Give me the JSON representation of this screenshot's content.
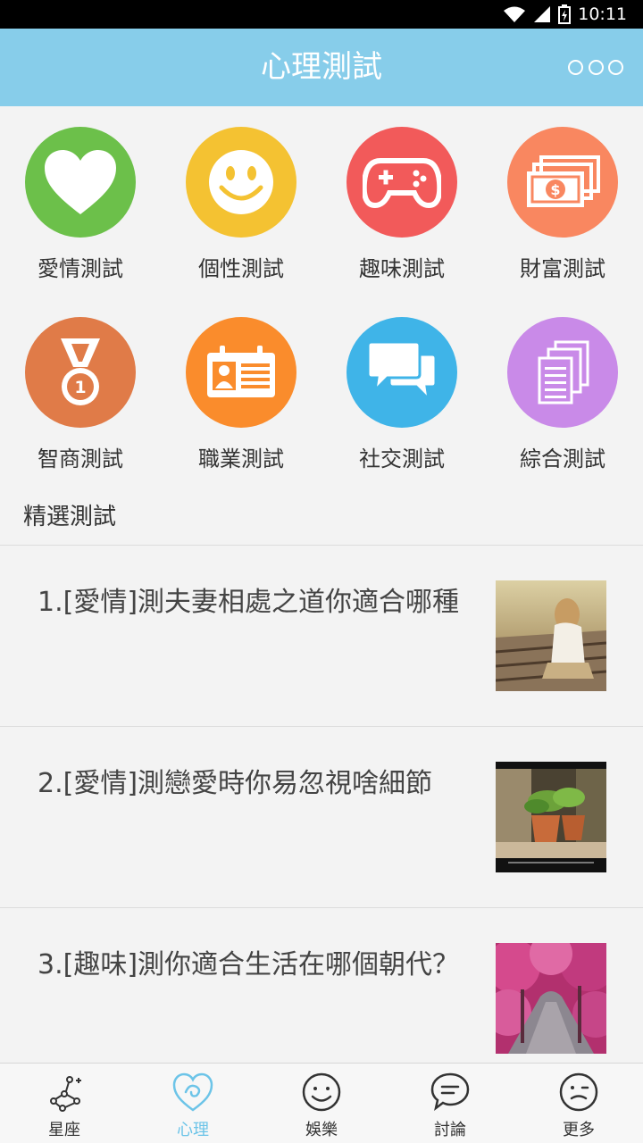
{
  "status_bar": {
    "time": "10:11",
    "icons": [
      "wifi-icon",
      "signal-icon",
      "battery-icon"
    ]
  },
  "header": {
    "title": "心理測試",
    "menu_icon": "more-dots-icon"
  },
  "categories": [
    {
      "label": "愛情測試",
      "icon": "heart-icon",
      "color": "#6cc04a"
    },
    {
      "label": "個性測試",
      "icon": "smiley-icon",
      "color": "#f4c232"
    },
    {
      "label": "趣味測試",
      "icon": "gamepad-icon",
      "color": "#f25a5a"
    },
    {
      "label": "財富測試",
      "icon": "money-icon",
      "color": "#f98760"
    },
    {
      "label": "智商測試",
      "icon": "medal-icon",
      "color": "#e07b48",
      "badge": "1"
    },
    {
      "label": "職業測試",
      "icon": "id-card-icon",
      "color": "#fa8c2c"
    },
    {
      "label": "社交測試",
      "icon": "chat-icon",
      "color": "#3fb4e8"
    },
    {
      "label": "綜合測試",
      "icon": "documents-icon",
      "color": "#c98ae8"
    }
  ],
  "featured": {
    "title": "精選測試",
    "items": [
      {
        "title": "1.[愛情]測夫妻相處之道你適合哪種",
        "thumb": "photo-girl-on-railway"
      },
      {
        "title": "2.[愛情]測戀愛時你易忽視啥細節",
        "thumb": "photo-potted-plants"
      },
      {
        "title": "3.[趣味]測你適合生活在哪個朝代？",
        "thumb": "photo-pink-tree-road"
      }
    ]
  },
  "bottom_nav": {
    "active_color": "#6cc4e8",
    "items": [
      {
        "label": "星座",
        "icon": "constellation-icon"
      },
      {
        "label": "心理",
        "icon": "psychology-heart-icon",
        "active": true
      },
      {
        "label": "娛樂",
        "icon": "smile-face-icon"
      },
      {
        "label": "討論",
        "icon": "chat-bubble-icon"
      },
      {
        "label": "更多",
        "icon": "wink-face-icon"
      }
    ]
  }
}
